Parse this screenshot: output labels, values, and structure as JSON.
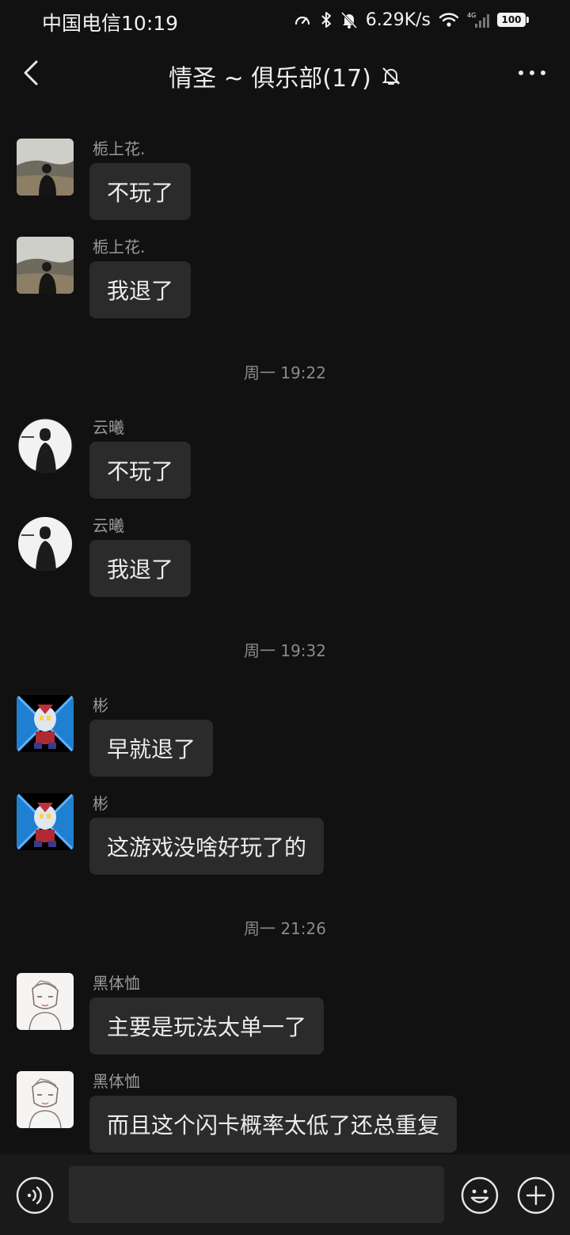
{
  "status_bar": {
    "carrier": "中国电信",
    "time": "10:19",
    "net_speed": "6.29K/s",
    "battery": "100",
    "signal_type": "4G"
  },
  "header": {
    "title": "情圣 ~ 俱乐部(17)",
    "icons": [
      "back-icon",
      "mute-bell-icon",
      "more-dots-icon"
    ]
  },
  "messages": [
    {
      "sender": "栀上花.",
      "text": "不玩了",
      "avatar": "landscape-person"
    },
    {
      "sender": "栀上花.",
      "text": "我退了",
      "avatar": "landscape-person"
    },
    {
      "sender": "云曦",
      "text": "不玩了",
      "avatar": "circle-portrait"
    },
    {
      "sender": "云曦",
      "text": "我退了",
      "avatar": "circle-portrait"
    },
    {
      "sender": "彬",
      "text": "早就退了",
      "avatar": "blue-hero"
    },
    {
      "sender": "彬",
      "text": "这游戏没啥好玩了的",
      "avatar": "blue-hero"
    },
    {
      "sender": "黑体恤",
      "text": "主要是玩法太单一了",
      "avatar": "sketch-portrait"
    },
    {
      "sender": "黑体恤",
      "text": "而且这个闪卡概率太低了还总重复",
      "avatar": "sketch-portrait"
    }
  ],
  "timestamps": [
    "周一 19:22",
    "周一 19:32",
    "周一 21:26"
  ],
  "input_bar": {
    "icons": [
      "voice-icon",
      "emoji-icon",
      "plus-icon"
    ],
    "value": ""
  },
  "colors": {
    "background": "#111111",
    "bubble": "#2b2b2b",
    "input_bar": "#1a1a1a"
  }
}
